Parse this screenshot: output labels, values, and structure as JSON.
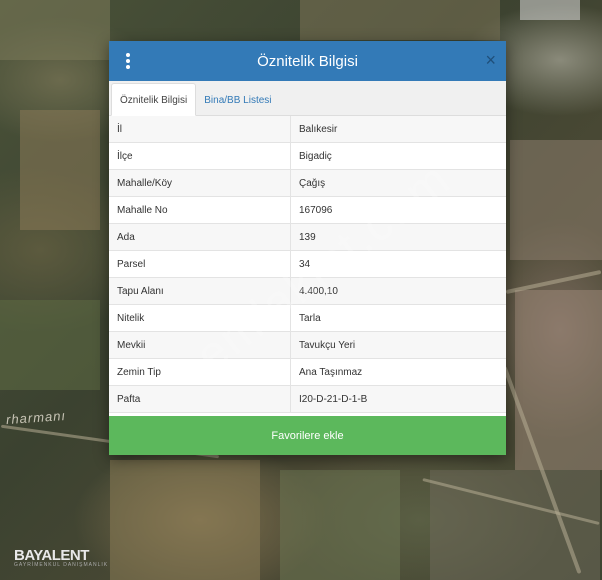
{
  "map": {
    "place_label": "rharmanı"
  },
  "watermark": "emlakjet.com",
  "logo": {
    "text_main": "BAYALENT",
    "text_sub": "GAYRİMENKUL DANIŞMANLIK"
  },
  "modal": {
    "title": "Öznitelik Bilgisi",
    "close_symbol": "×",
    "tabs": [
      {
        "label": "Öznitelik Bilgisi",
        "active": true
      },
      {
        "label": "Bina/BB Listesi",
        "active": false
      }
    ],
    "rows": [
      {
        "key": "İl",
        "value": "Balıkesir"
      },
      {
        "key": "İlçe",
        "value": "Bigadiç"
      },
      {
        "key": "Mahalle/Köy",
        "value": "Çağış"
      },
      {
        "key": "Mahalle No",
        "value": "167096"
      },
      {
        "key": "Ada",
        "value": "139"
      },
      {
        "key": "Parsel",
        "value": "34"
      },
      {
        "key": "Tapu Alanı",
        "value": "4.400,10"
      },
      {
        "key": "Nitelik",
        "value": "Tarla"
      },
      {
        "key": "Mevkii",
        "value": "Tavukçu Yeri"
      },
      {
        "key": "Zemin Tip",
        "value": "Ana Taşınmaz"
      },
      {
        "key": "Pafta",
        "value": "I20-D-21-D-1-B"
      }
    ],
    "favorite_button": "Favorilere ekle"
  },
  "colors": {
    "header": "#337ab7",
    "button": "#5cb85c"
  }
}
